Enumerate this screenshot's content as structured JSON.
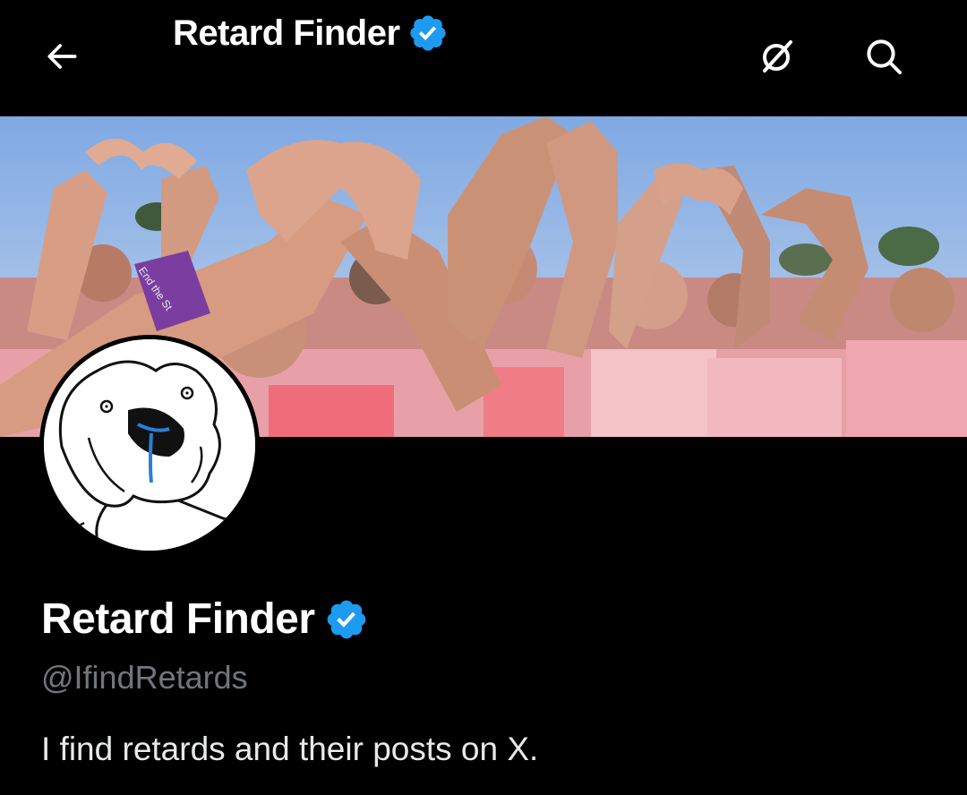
{
  "header": {
    "title": "Retard Finder",
    "back_icon": "arrow-left-icon",
    "grok_icon": "grok-icon",
    "search_icon": "search-icon"
  },
  "profile": {
    "display_name": "Retard Finder",
    "handle": "@IfindRetards",
    "bio": "I find retards and their posts on X.",
    "verified": true,
    "verified_color": "#1d9bf0"
  },
  "banner": {
    "banner_text": "End the St"
  },
  "colors": {
    "background": "#000000",
    "primary_text": "#ffffff",
    "secondary_text": "#71767b",
    "accent": "#1d9bf0"
  }
}
